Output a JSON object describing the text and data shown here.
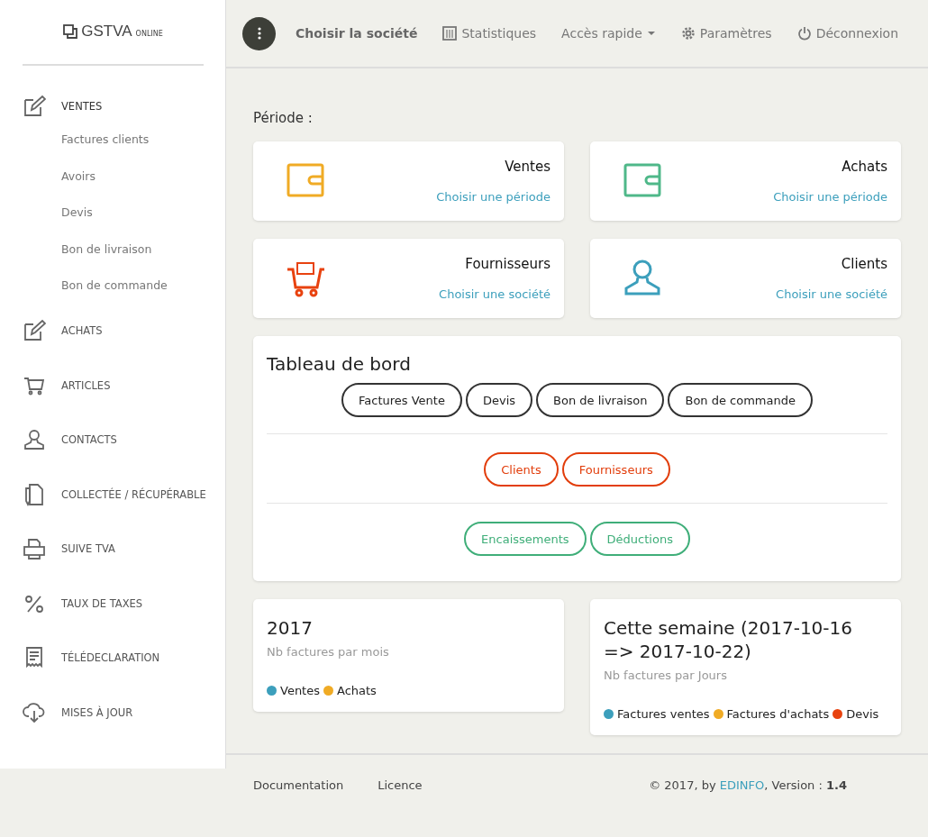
{
  "sidebar": {
    "logo": {
      "name": "GSTVA",
      "suffix": "ONLINE"
    },
    "items": [
      {
        "label": "VENTES",
        "expanded": true,
        "children": [
          {
            "label": "Factures clients"
          },
          {
            "label": "Avoirs"
          },
          {
            "label": "Devis"
          },
          {
            "label": "Bon de livraison"
          },
          {
            "label": "Bon de commande"
          }
        ]
      },
      {
        "label": "ACHATS",
        "expanded": false
      },
      {
        "label": "ARTICLES",
        "expanded": false
      },
      {
        "label": "CONTACTS",
        "expanded": false
      },
      {
        "label": "COLLECTÉE / RÉCUPÉRABLE",
        "expanded": false
      },
      {
        "label": "SUIVE TVA",
        "expanded": false
      },
      {
        "label": "TAUX DE TAXES",
        "expanded": false
      },
      {
        "label": "TÉLÉDECLARATION",
        "expanded": false
      },
      {
        "label": "MISES À JOUR",
        "expanded": false
      }
    ]
  },
  "navbar": {
    "items": [
      {
        "label": "Choisir la société",
        "kind": "plain"
      },
      {
        "label": "Statistiques",
        "kind": "icon"
      },
      {
        "label": "Accès rapide",
        "kind": "dropdown"
      },
      {
        "label": "Paramètres",
        "kind": "icon"
      },
      {
        "label": "Déconnexion",
        "kind": "icon"
      }
    ]
  },
  "period_label": "Période :",
  "cards": [
    {
      "title": "Ventes",
      "link": "Choisir une période",
      "color": "#f0ab25"
    },
    {
      "title": "Achats",
      "link": "Choisir une période",
      "color": "#4fb889"
    },
    {
      "title": "Fournisseurs",
      "link": "Choisir une société",
      "color": "#e8420f"
    },
    {
      "title": "Clients",
      "link": "Choisir une société",
      "color": "#3c9fbc"
    }
  ],
  "dashboard": {
    "title": "Tableau de bord",
    "groups": [
      {
        "color": "#333333",
        "buttons": [
          "Factures Vente",
          "Devis",
          "Bon de livraison",
          "Bon de commande"
        ]
      },
      {
        "color": "#e23d0b",
        "buttons": [
          "Clients",
          "Fournisseurs"
        ]
      },
      {
        "color": "#3fae79",
        "buttons": [
          "Encaissements",
          "Déductions"
        ]
      }
    ]
  },
  "stats": [
    {
      "title": "2017",
      "subtitle": "Nb factures par mois",
      "legend": [
        {
          "label": "Ventes",
          "color": "#3c9fbc"
        },
        {
          "label": "Achats",
          "color": "#f0ab25"
        }
      ]
    },
    {
      "title": "Cette semaine (2017-10-16 => 2017-10-22)",
      "subtitle": "Nb factures par Jours",
      "legend": [
        {
          "label": "Factures ventes",
          "color": "#3c9fbc"
        },
        {
          "label": "Factures d'achats",
          "color": "#f0ab25"
        },
        {
          "label": "Devis",
          "color": "#e8420f"
        }
      ]
    }
  ],
  "footer": {
    "links": [
      "Documentation",
      "Licence"
    ],
    "credit_prefix": "© 2017, by ",
    "credit_link": "EDINFO",
    "credit_suffix": ", Version : **1.4**"
  }
}
